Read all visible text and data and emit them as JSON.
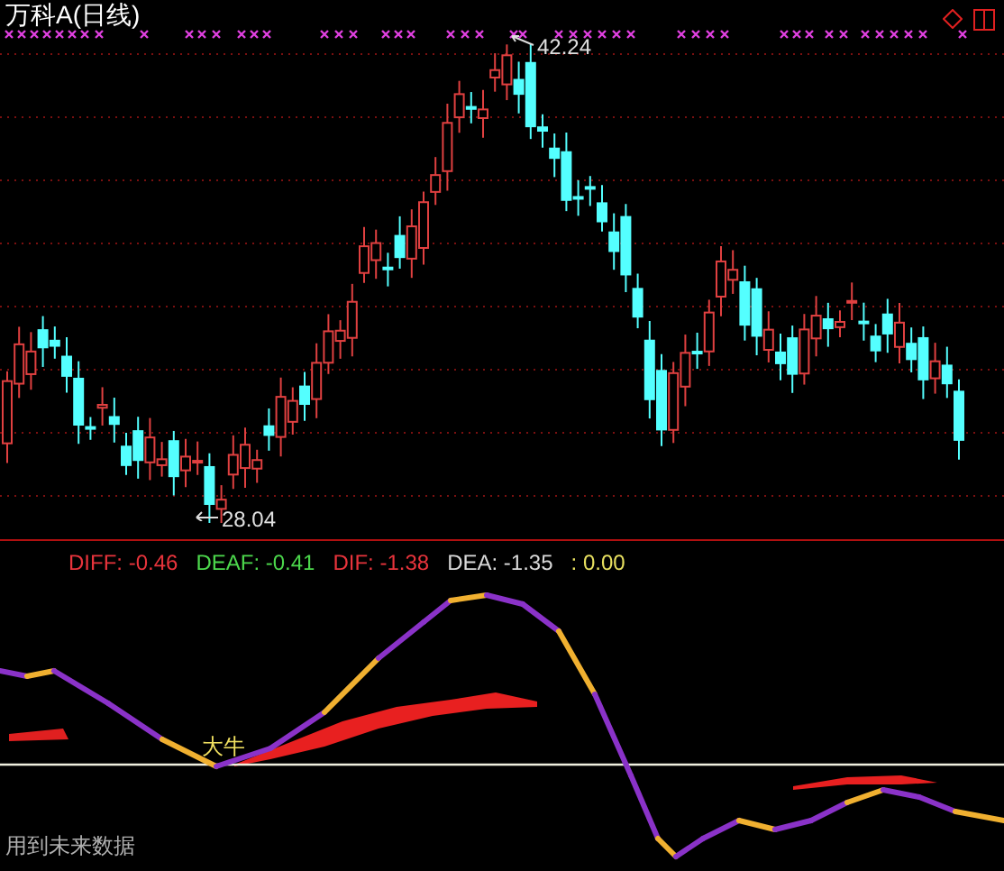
{
  "chart_title": "万科A(日线)",
  "high_label": "42.24",
  "low_label": "28.04",
  "indicators": [
    {
      "text": "DIFF: -0.46",
      "color": "#e8343c"
    },
    {
      "text": "DEAF: -0.41",
      "color": "#4cd74c"
    },
    {
      "text": "DIF: -1.38",
      "color": "#e8343c"
    },
    {
      "text": "DEA: -1.35",
      "color": "#d8d8d8"
    },
    {
      "text": ": 0.00",
      "color": "#e8e060"
    }
  ],
  "signal_label": "大牛",
  "note": "用到未来数据"
}
